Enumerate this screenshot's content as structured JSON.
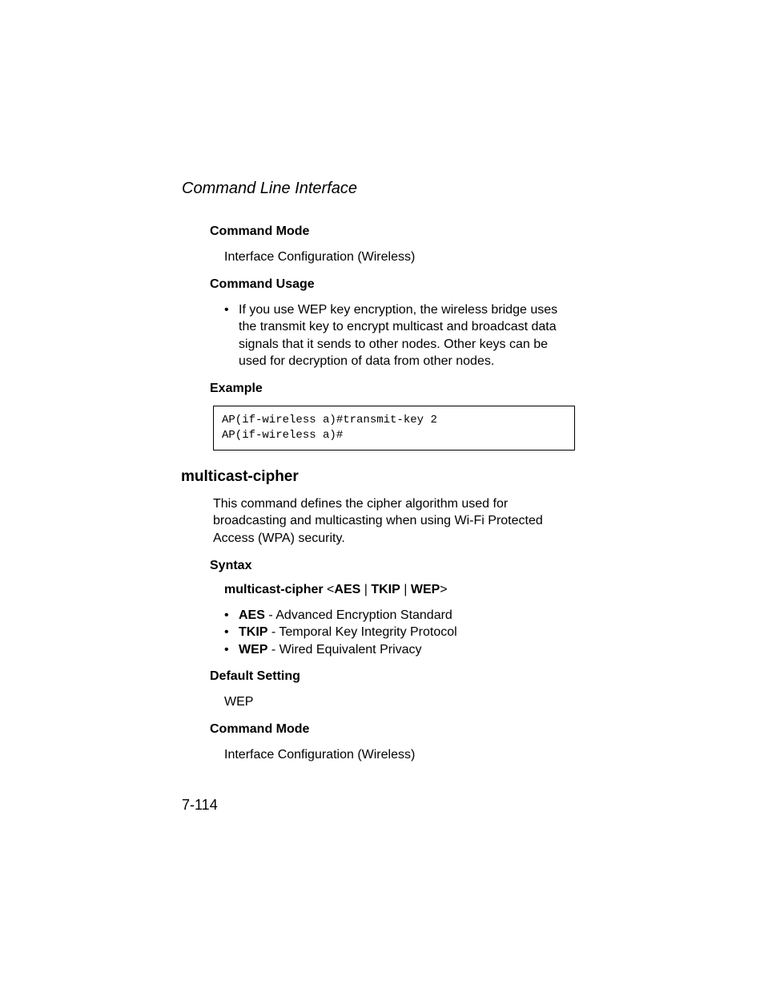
{
  "header": "Command Line Interface",
  "s1": {
    "cmdMode": {
      "heading": "Command Mode",
      "text": "Interface Configuration (Wireless)"
    },
    "cmdUsage": {
      "heading": "Command Usage",
      "bullet": "If you use WEP key encryption, the wireless bridge uses the transmit key to encrypt multicast and broadcast data signals that it sends to other nodes. Other keys can be used for decryption of data from other nodes."
    },
    "example": {
      "heading": "Example",
      "code": "AP(if-wireless a)#transmit-key 2\nAP(if-wireless a)#"
    }
  },
  "s2": {
    "title": "multicast-cipher",
    "intro": "This command defines the cipher algorithm used for broadcasting and multicasting when using Wi-Fi Protected Access (WPA) security.",
    "syntax": {
      "heading": "Syntax",
      "cmd": "multicast-cipher",
      "lt": "<",
      "opt1": "AES",
      "sep": " | ",
      "opt2": "TKIP",
      "opt3": "WEP",
      "gt": ">",
      "options": [
        {
          "key": "AES",
          "desc": " - Advanced Encryption Standard"
        },
        {
          "key": "TKIP",
          "desc": " - Temporal Key Integrity Protocol"
        },
        {
          "key": "WEP",
          "desc": " - Wired Equivalent Privacy"
        }
      ]
    },
    "default": {
      "heading": "Default Setting",
      "text": "WEP"
    },
    "cmdMode": {
      "heading": "Command Mode",
      "text": "Interface Configuration (Wireless)"
    }
  },
  "pageNumber": "7-114",
  "bullet": "•"
}
